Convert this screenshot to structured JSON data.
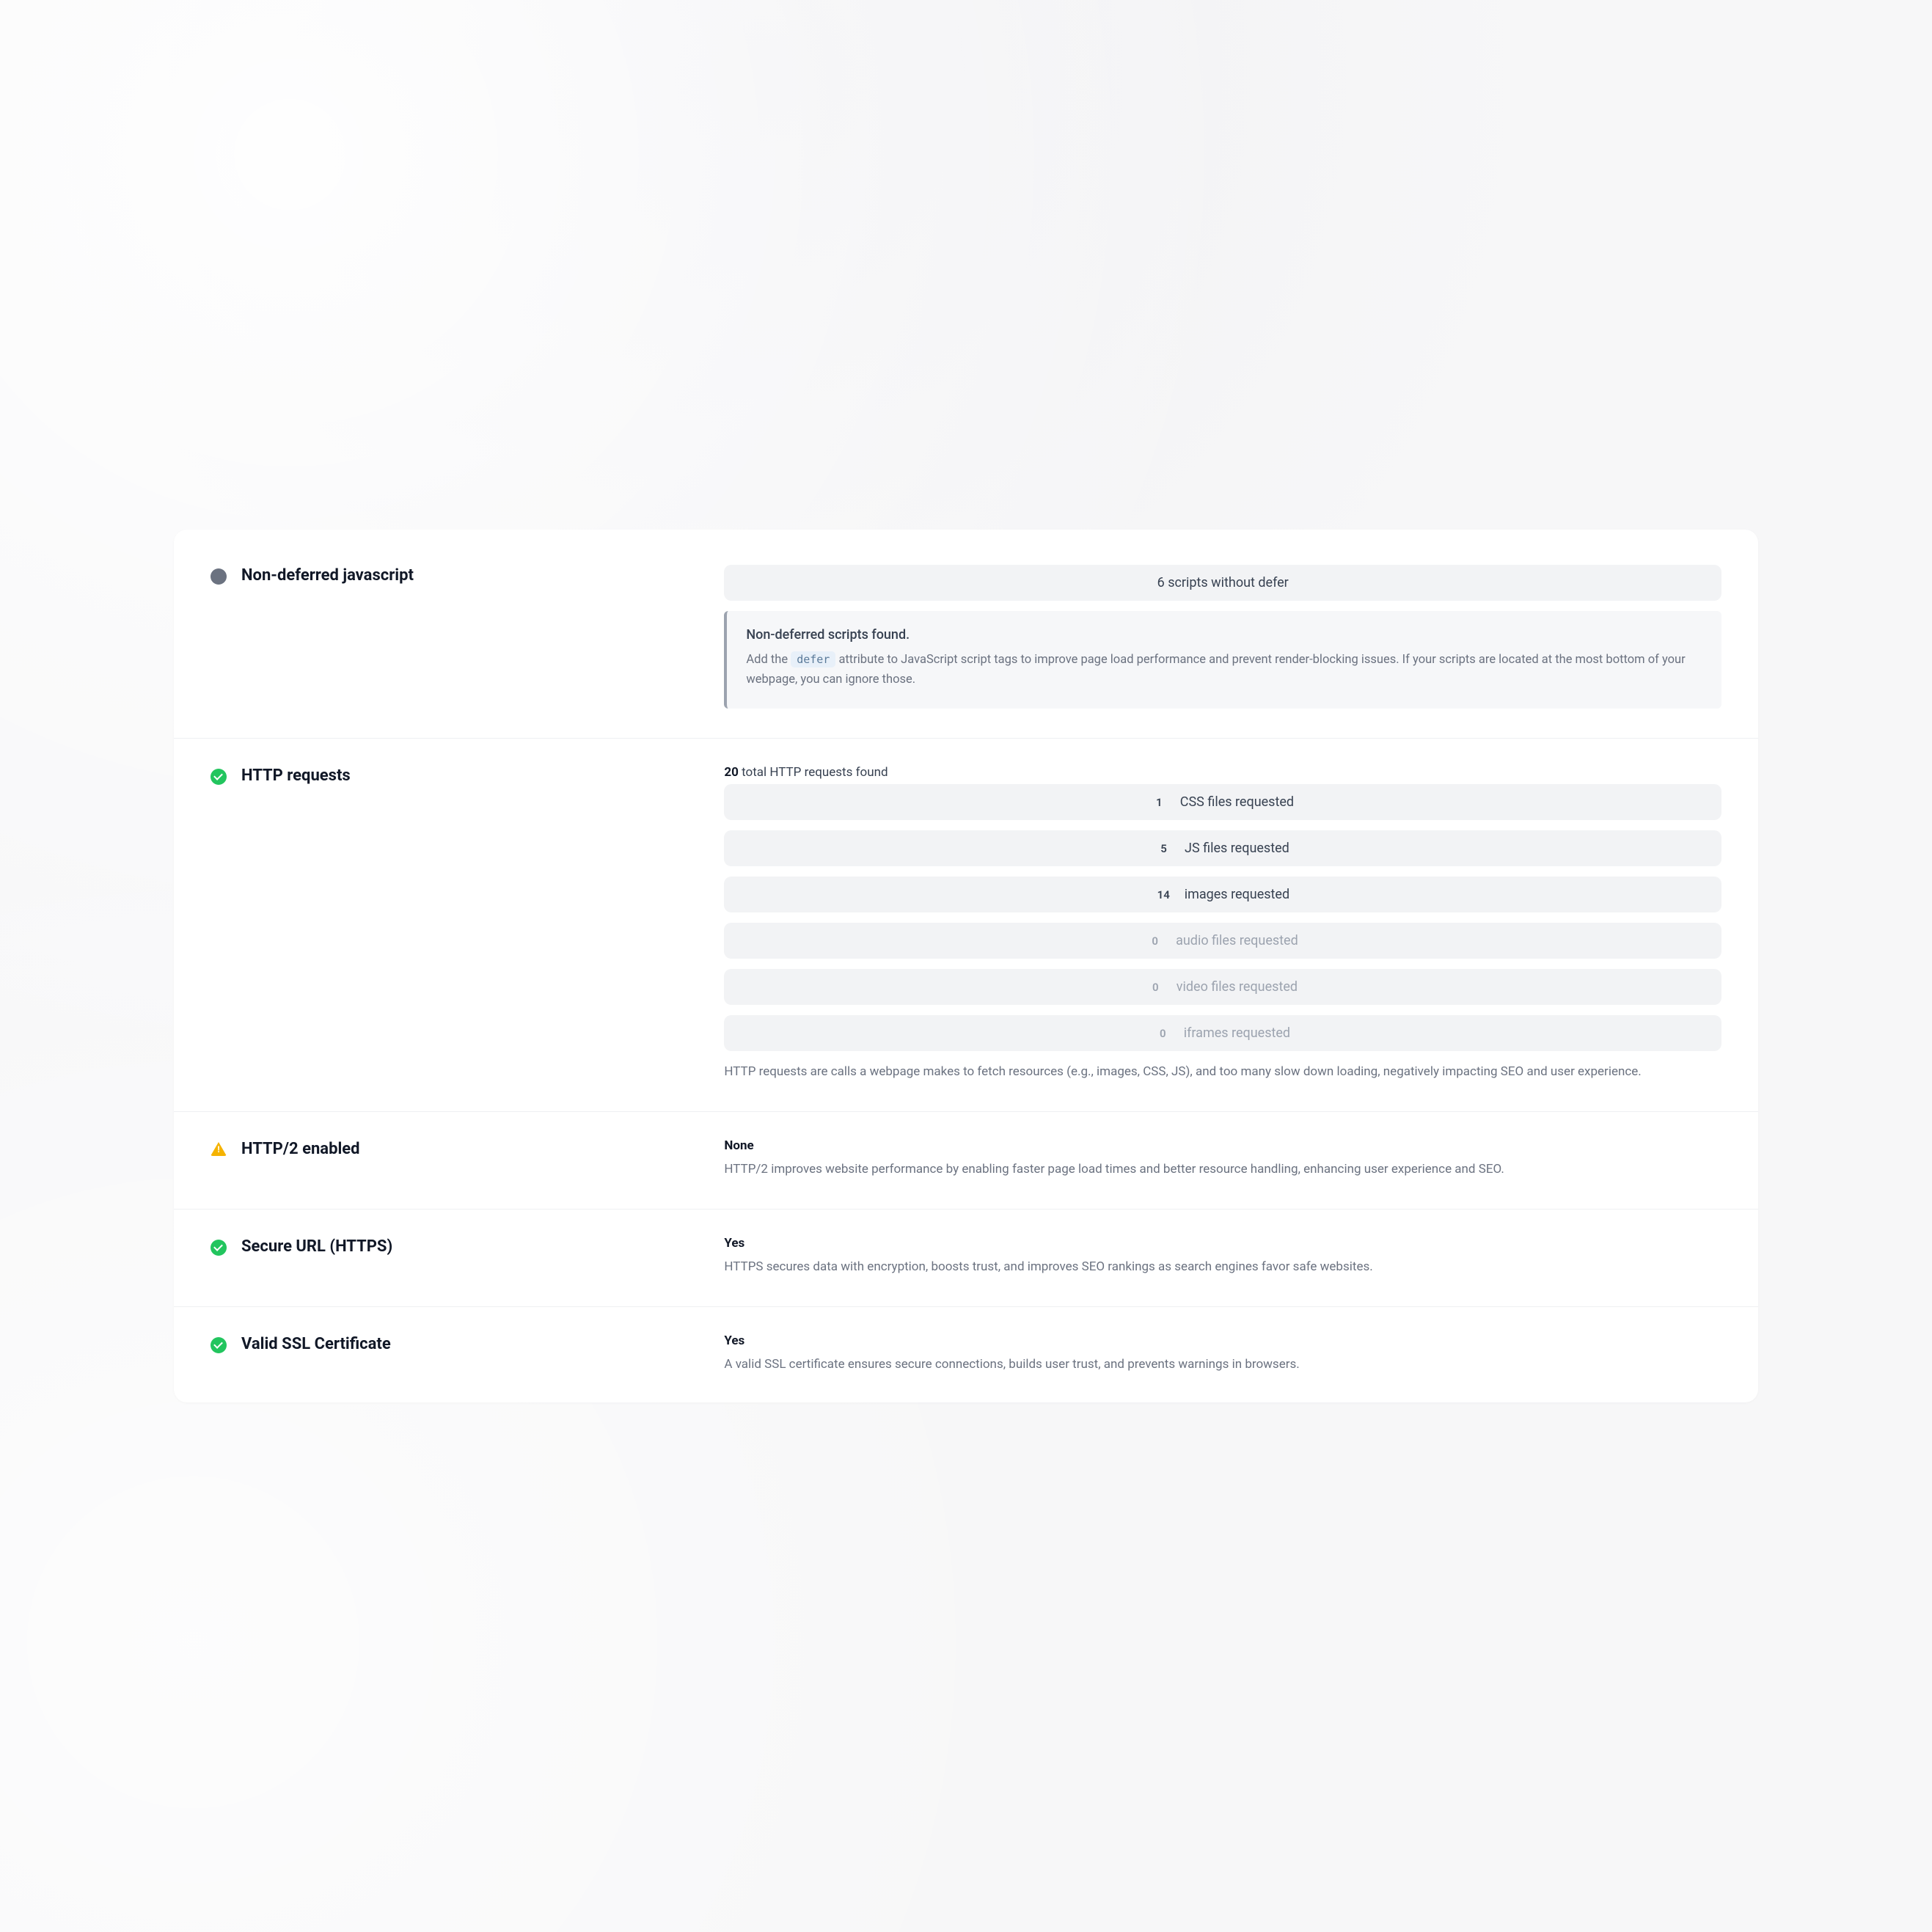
{
  "sections": {
    "nondeferred": {
      "title": "Non-deferred javascript",
      "summary_badge": "6 scripts without defer",
      "callout_title": "Non-deferred scripts found.",
      "callout_prefix": "Add the ",
      "callout_code": "defer",
      "callout_suffix": " attribute to JavaScript script tags to improve page load performance and prevent render-blocking issues. If your scripts are located at the most bottom of your webpage, you can ignore those."
    },
    "http_requests": {
      "title": "HTTP requests",
      "total_count": "20",
      "total_suffix": " total HTTP requests found",
      "items": [
        {
          "count": "1",
          "label": "CSS files requested",
          "muted": false
        },
        {
          "count": "5",
          "label": "JS files requested",
          "muted": false
        },
        {
          "count": "14",
          "label": "images requested",
          "muted": false
        },
        {
          "count": "0",
          "label": "audio files requested",
          "muted": true
        },
        {
          "count": "0",
          "label": "video files requested",
          "muted": true
        },
        {
          "count": "0",
          "label": "iframes requested",
          "muted": true
        }
      ],
      "description": "HTTP requests are calls a webpage makes to fetch resources (e.g., images, CSS, JS), and too many slow down loading, negatively impacting SEO and user experience."
    },
    "http2": {
      "title": "HTTP/2 enabled",
      "value": "None",
      "description": "HTTP/2 improves website performance by enabling faster page load times and better resource handling, enhancing user experience and SEO."
    },
    "https": {
      "title": "Secure URL (HTTPS)",
      "value": "Yes",
      "description": "HTTPS secures data with encryption, boosts trust, and improves SEO rankings as search engines favor safe websites."
    },
    "ssl": {
      "title": "Valid SSL Certificate",
      "value": "Yes",
      "description": "A valid SSL certificate ensures secure connections, builds user trust, and prevents warnings in browsers."
    }
  }
}
